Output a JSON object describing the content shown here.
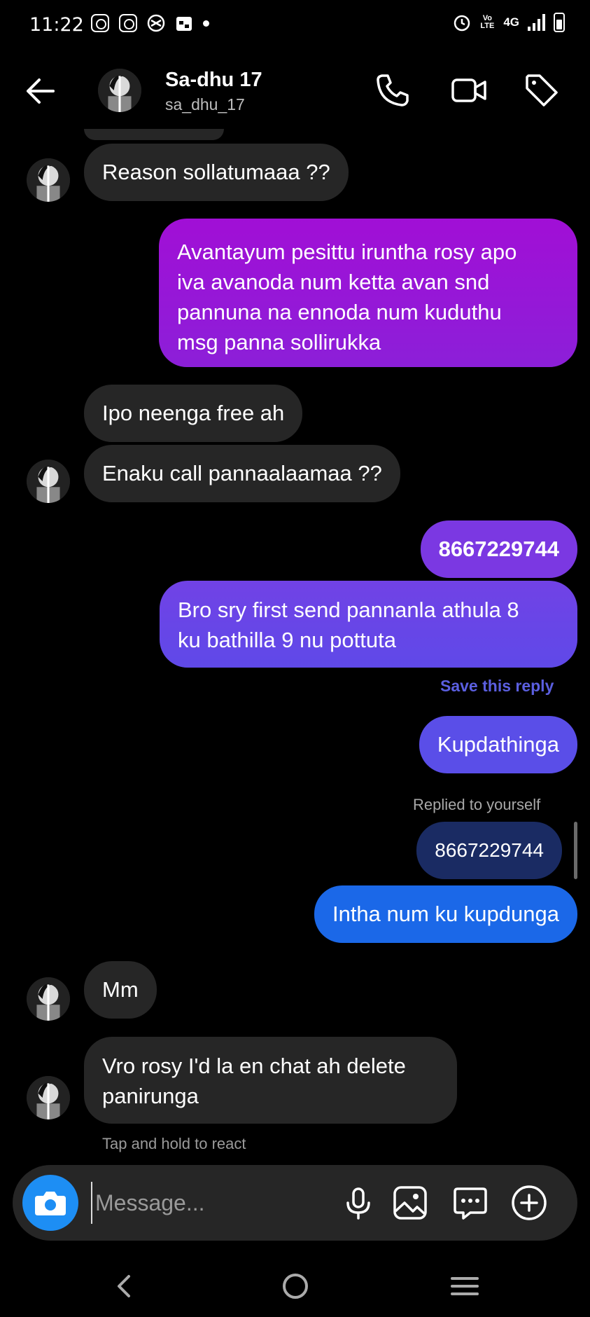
{
  "status_bar": {
    "time": "11:22",
    "network": "4G",
    "volte": "Vo LTE",
    "icons": [
      "instagram-icon",
      "instagram-icon",
      "vpn-icon",
      "calendar-icon",
      "notification-dot",
      "alarm-icon",
      "signal-icon",
      "battery-icon"
    ]
  },
  "header": {
    "contact_name": "Sa-dhu 17",
    "contact_handle": "sa_dhu_17",
    "icons": [
      "back-arrow-icon",
      "phone-icon",
      "video-icon",
      "tag-icon"
    ]
  },
  "messages": [
    {
      "side": "in",
      "text": "Reason sollatumaaa ??"
    },
    {
      "side": "out",
      "lines": [
        "Avantayum pesittu iruntha rosy apo",
        "iva avanoda num ketta avan snd",
        "pannuna na ennoda num kuduthu",
        "msg panna sollirukka"
      ]
    },
    {
      "side": "in",
      "text": "Ipo neenga free ah"
    },
    {
      "side": "in",
      "text": "Enaku call pannaalaamaa ??"
    },
    {
      "side": "out",
      "text": "8667229744"
    },
    {
      "side": "out",
      "lines": [
        "Bro sry first send pannanla athula 8",
        "ku bathilla 9 nu pottuta"
      ]
    },
    {
      "side": "out",
      "text": "Kupdathinga"
    },
    {
      "side": "out",
      "text": "8667229744",
      "reply_quote": true
    },
    {
      "side": "out",
      "text": "Intha num ku kupdunga"
    },
    {
      "side": "in",
      "text": "Mm"
    },
    {
      "side": "in",
      "lines": [
        "Vro rosy I'd la en chat ah delete",
        "panirunga"
      ]
    }
  ],
  "notes": {
    "save_reply": "Save this reply",
    "replied_to_yourself": "Replied to yourself",
    "tap_hint": "Tap and hold to react"
  },
  "composer": {
    "placeholder": "Message...",
    "icons": [
      "camera-icon",
      "microphone-icon",
      "gallery-icon",
      "sticker-icon",
      "add-icon"
    ]
  },
  "nav_bar": {
    "icons": [
      "nav-back-icon",
      "nav-home-icon",
      "nav-recents-icon"
    ]
  },
  "colors": {
    "incoming_bubble": "#262626",
    "outgoing_purple": "#a10fd6",
    "outgoing_violet": "#7142e6",
    "outgoing_indigo": "#5a4ee8",
    "quoted_reply": "#1a2b63",
    "outgoing_blue": "#1b68e8",
    "camera_button": "#1d8ef4",
    "save_reply_text": "#5b5fe0"
  }
}
